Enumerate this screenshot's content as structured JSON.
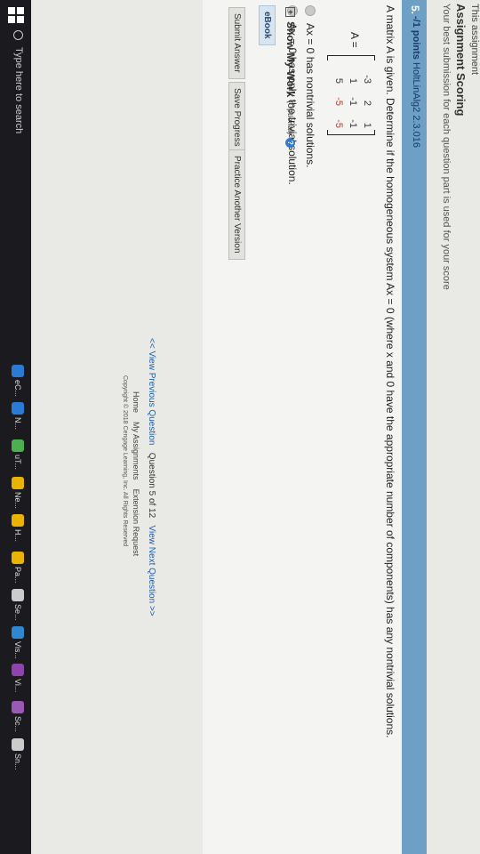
{
  "header": {
    "top_title": "This assignment",
    "scoring_title": "Assignment Scoring",
    "scoring_desc": "Your best submission for each question part is used for your score"
  },
  "question": {
    "number": "5.",
    "points": "-/1 points",
    "reference": "HoltLinAlg2 2.3.016",
    "prompt": "A matrix A is given. Determine if the homogeneous system Ax = 0 (where x and 0 have the appropriate number of components) has any nontrivial solutions.",
    "matrix_label": "A =",
    "matrix": [
      [
        "-3",
        "2",
        "1"
      ],
      [
        "1",
        "-1",
        "-1"
      ],
      [
        "5",
        "-5",
        "-5"
      ]
    ],
    "options": [
      "Ax = 0 has nontrivial solutions.",
      "Ax = 0 has only the trivial solution."
    ],
    "ebook_label": "eBook"
  },
  "show_my_work": {
    "title": "Show My Work",
    "optional": "(Optional)",
    "help": "?"
  },
  "buttons": {
    "submit": "Submit Answer",
    "save": "Save Progress",
    "practice": "Practice Another Version"
  },
  "navigation": {
    "prev": "<< View Previous Question",
    "current": "Question 5 of 12",
    "next": "View Next Question >>"
  },
  "footer": {
    "home": "Home",
    "my_assignments": "My Assignments",
    "extension": "Extension Request",
    "copyright": "Copyright © 2018 Cengage Learning, Inc. All Rights Reserved"
  },
  "taskbar": {
    "search_placeholder": "Type here to search",
    "apps": [
      {
        "label": "eC...",
        "color": "#2b7bd6"
      },
      {
        "label": "N...",
        "color": "#2b7bd6"
      },
      {
        "label": "uT...",
        "color": "#4caf50"
      },
      {
        "label": "Ne...",
        "color": "#e8b400"
      },
      {
        "label": "H...",
        "color": "#e8b400"
      },
      {
        "label": "Pa...",
        "color": "#e8b400"
      },
      {
        "label": "Se...",
        "color": "#cccccc"
      },
      {
        "label": "Vis...",
        "color": "#2f87d0"
      },
      {
        "label": "Vi...",
        "color": "#8e44ad"
      },
      {
        "label": "Sc...",
        "color": "#9b59b6"
      },
      {
        "label": "Sn...",
        "color": "#cccccc"
      }
    ]
  }
}
